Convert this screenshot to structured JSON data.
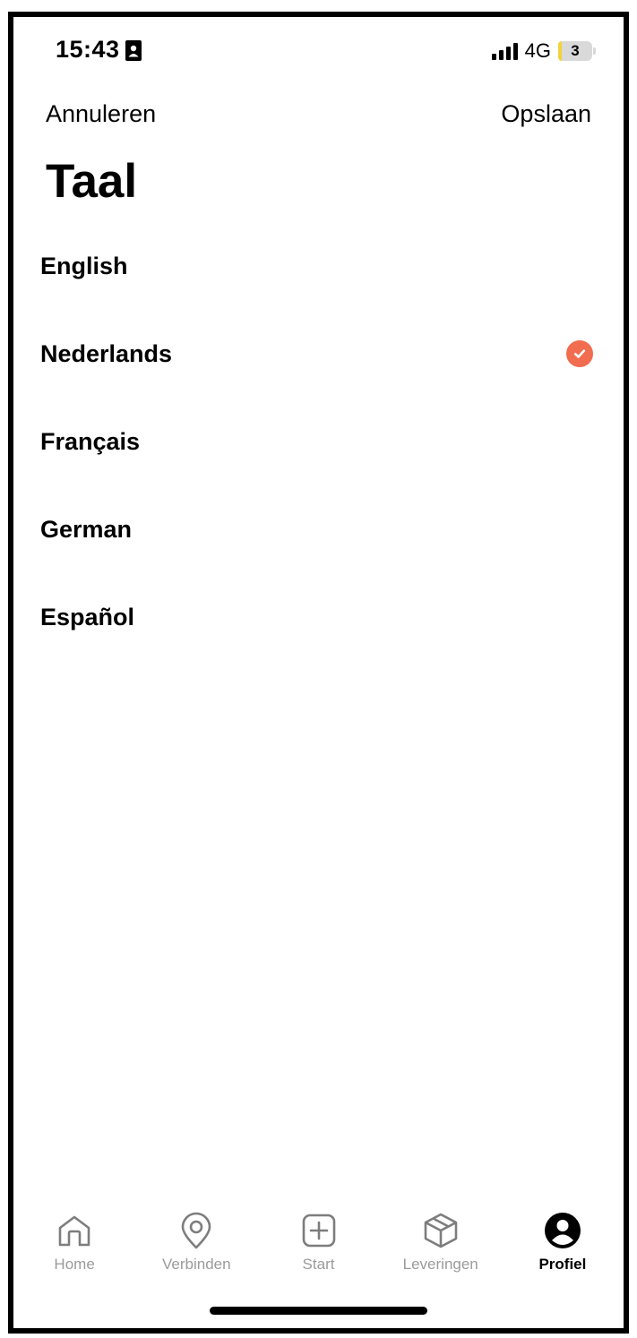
{
  "status_bar": {
    "time": "15:43",
    "network": "4G",
    "battery_level": "3",
    "icons": [
      "contact-card-icon",
      "signal-icon",
      "battery-icon"
    ]
  },
  "nav": {
    "cancel_label": "Annuleren",
    "save_label": "Opslaan"
  },
  "page": {
    "title": "Taal"
  },
  "languages": [
    {
      "label": "English",
      "selected": false
    },
    {
      "label": "Nederlands",
      "selected": true
    },
    {
      "label": "Français",
      "selected": false
    },
    {
      "label": "German",
      "selected": false
    },
    {
      "label": "Español",
      "selected": false
    }
  ],
  "tab_bar": {
    "items": [
      {
        "label": "Home",
        "icon": "home-icon",
        "active": false
      },
      {
        "label": "Verbinden",
        "icon": "location-pin-icon",
        "active": false
      },
      {
        "label": "Start",
        "icon": "plus-square-icon",
        "active": false
      },
      {
        "label": "Leveringen",
        "icon": "package-box-icon",
        "active": false
      },
      {
        "label": "Profiel",
        "icon": "profile-avatar-icon",
        "active": true
      }
    ]
  },
  "colors": {
    "accent": "#f26c4f",
    "inactive_tab": "#9b9b9b",
    "text": "#000000",
    "background": "#ffffff"
  }
}
